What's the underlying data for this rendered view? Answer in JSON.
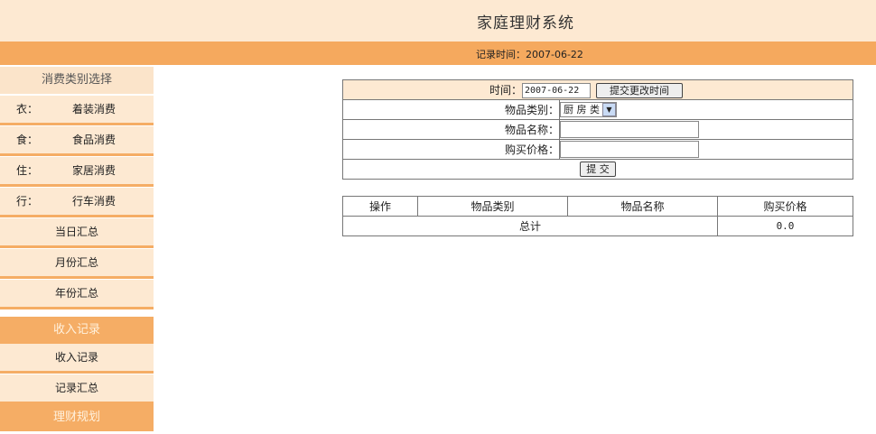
{
  "header": {
    "title": "家庭理财系统"
  },
  "datebar": {
    "label": "记录时间：2007-06-22"
  },
  "sidebar": {
    "category_title": "消费类别选择",
    "categories": [
      {
        "key": "衣：",
        "label": "着装消费"
      },
      {
        "key": "食：",
        "label": "食品消费"
      },
      {
        "key": "住：",
        "label": "家居消费"
      },
      {
        "key": "行：",
        "label": "行车消费"
      }
    ],
    "summaries": [
      "当日汇总",
      "月份汇总",
      "年份汇总"
    ],
    "income_title": "收入记录",
    "income_items": [
      "收入记录",
      "记录汇总"
    ],
    "finance_title": "理财规划"
  },
  "form": {
    "time_label": "时间：",
    "time_value": "2007-06-22",
    "time_button": "提交更改时间",
    "category_label": "物品类别：",
    "category_value": "厨 房 类",
    "name_label": "物品名称：",
    "price_label": "购买价格：",
    "submit_button": "提 交"
  },
  "table": {
    "headers": [
      "操作",
      "物品类别",
      "物品名称",
      "购买价格"
    ],
    "total_label": "总计",
    "total_value": "0.0"
  }
}
